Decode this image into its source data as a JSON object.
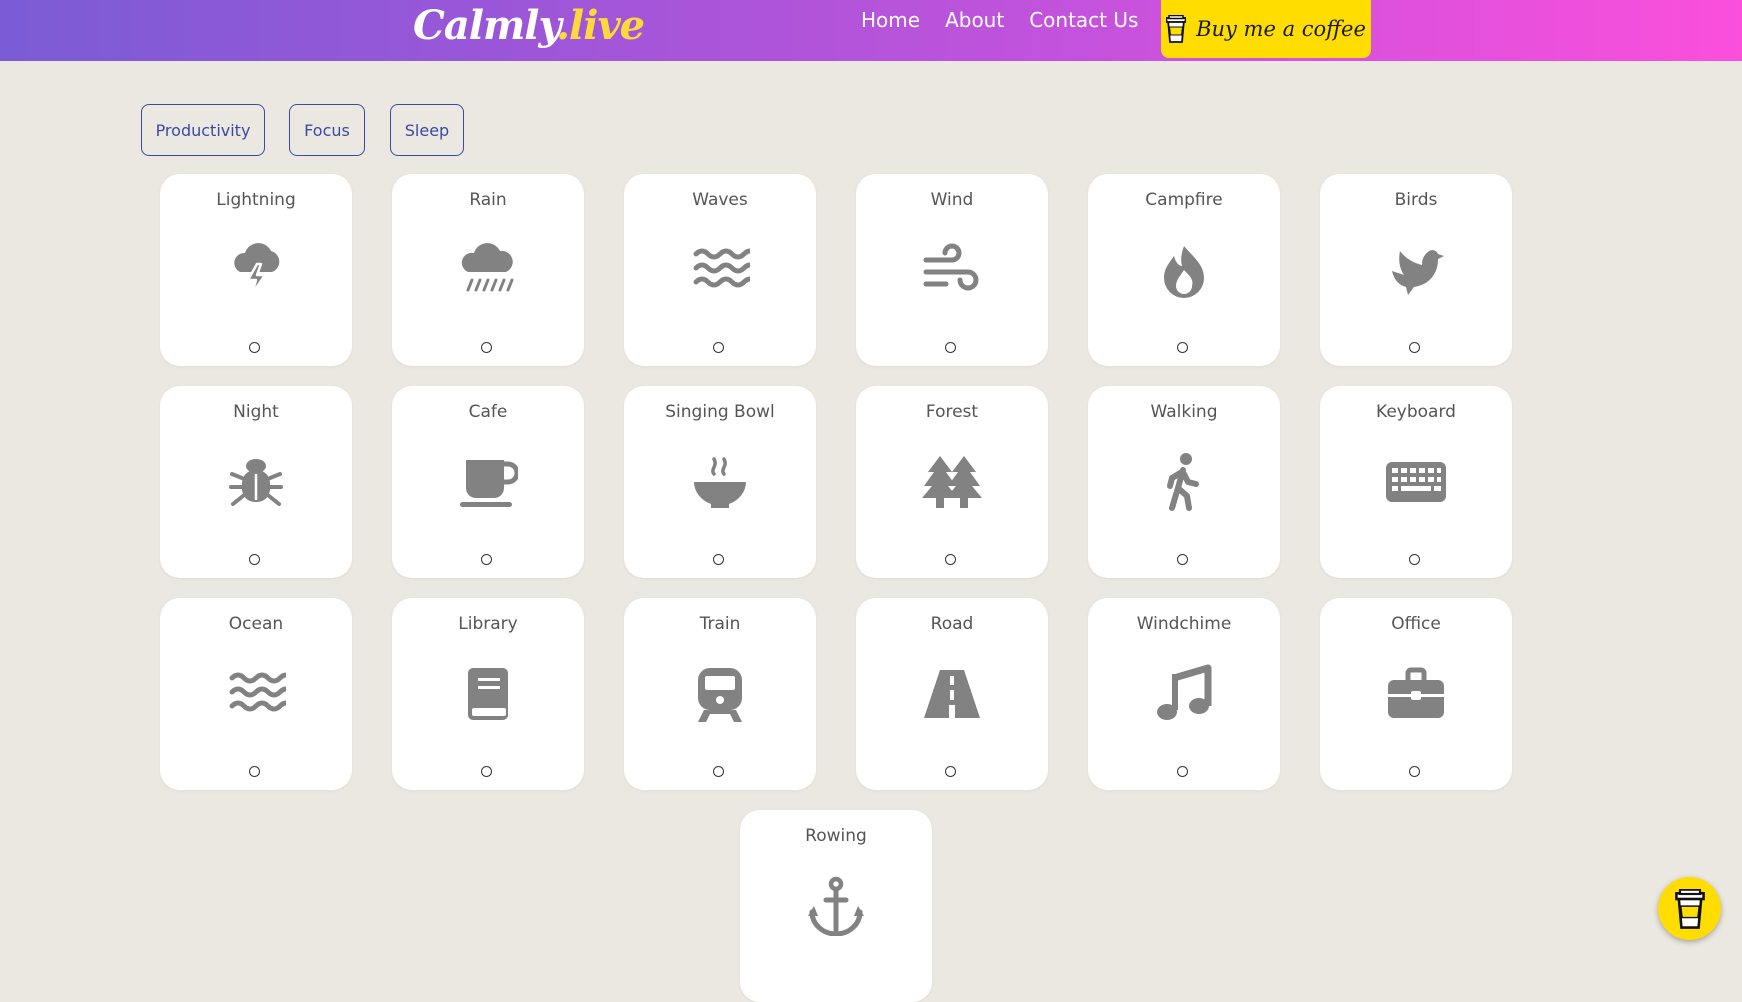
{
  "header": {
    "logo_main": "Calmly",
    "logo_tld": ".live",
    "nav": [
      "Home",
      "About",
      "Contact Us"
    ],
    "coffee_label": "Buy me a coffee",
    "coffee_icon": "coffee-cup-icon"
  },
  "filters": [
    "Productivity",
    "Focus",
    "Sleep"
  ],
  "icon_color": "#828282",
  "accent_colors": {
    "gradient_start": "#7b5cd6",
    "gradient_end": "#fb4fdc",
    "coffee": "#ffdd00",
    "filter_border": "#3b4aa0"
  },
  "sounds": [
    {
      "name": "Lightning",
      "icon": "storm-icon"
    },
    {
      "name": "Rain",
      "icon": "cloud-rain-icon"
    },
    {
      "name": "Waves",
      "icon": "water-icon"
    },
    {
      "name": "Wind",
      "icon": "wind-icon"
    },
    {
      "name": "Campfire",
      "icon": "fire-icon"
    },
    {
      "name": "Birds",
      "icon": "dove-icon"
    },
    {
      "name": "Night",
      "icon": "bug-icon"
    },
    {
      "name": "Cafe",
      "icon": "coffee-mug-icon"
    },
    {
      "name": "Singing Bowl",
      "icon": "bowl-steam-icon"
    },
    {
      "name": "Forest",
      "icon": "trees-icon"
    },
    {
      "name": "Walking",
      "icon": "person-walking-icon"
    },
    {
      "name": "Keyboard",
      "icon": "keyboard-icon"
    },
    {
      "name": "Ocean",
      "icon": "water-icon"
    },
    {
      "name": "Library",
      "icon": "book-icon"
    },
    {
      "name": "Train",
      "icon": "train-icon"
    },
    {
      "name": "Road",
      "icon": "road-icon"
    },
    {
      "name": "Windchime",
      "icon": "music-icon"
    },
    {
      "name": "Office",
      "icon": "briefcase-icon"
    },
    {
      "name": "Rowing",
      "icon": "anchor-icon"
    }
  ]
}
